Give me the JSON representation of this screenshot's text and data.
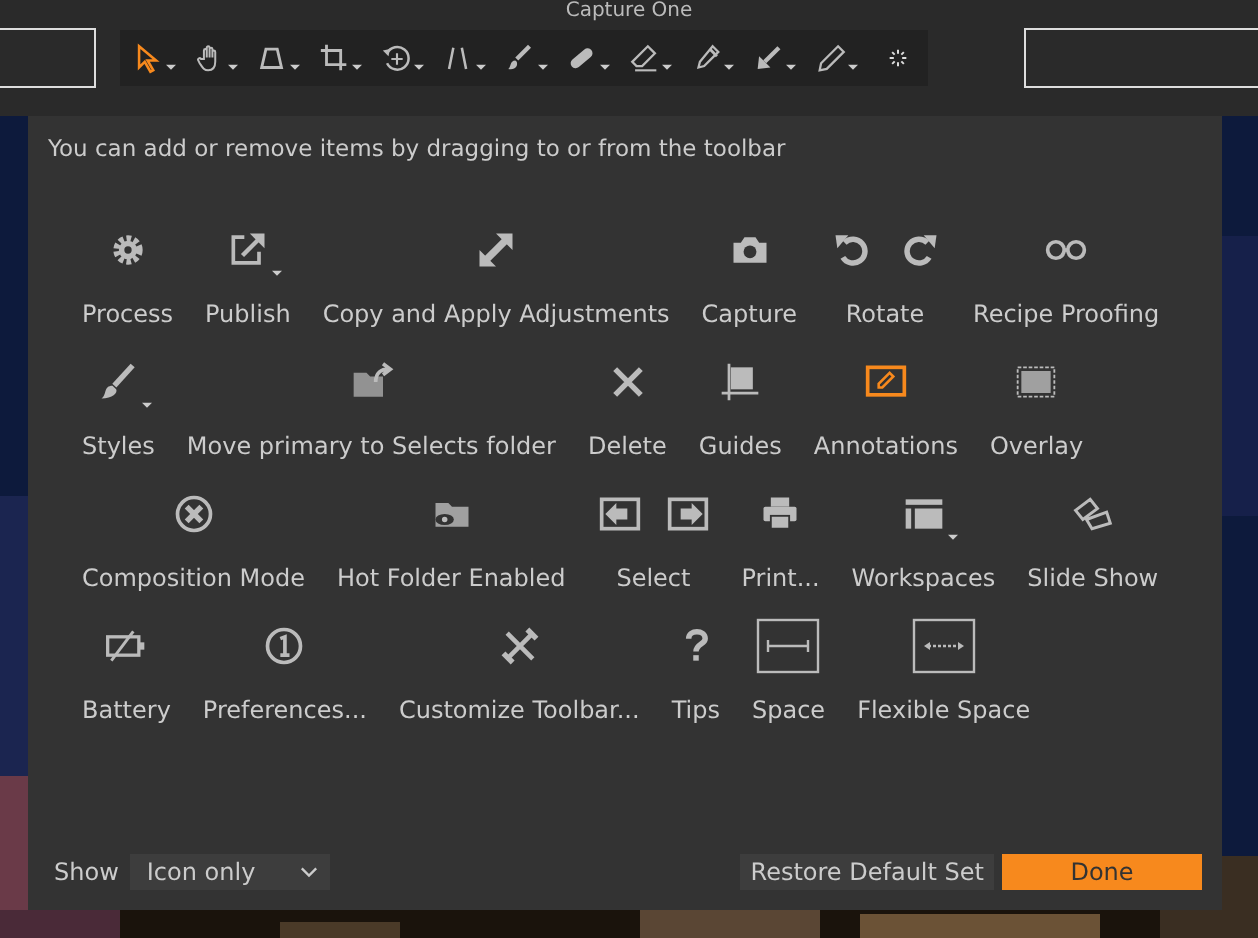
{
  "window": {
    "title": "Capture One"
  },
  "toolbar": [
    {
      "selected": true
    },
    {
      "selected": false
    },
    {
      "selected": false
    },
    {
      "selected": false
    },
    {
      "selected": false
    },
    {
      "selected": false
    },
    {
      "selected": false
    },
    {
      "selected": false
    },
    {
      "selected": false
    },
    {
      "selected": false
    },
    {
      "selected": false
    },
    {
      "selected": false
    }
  ],
  "dialog": {
    "hint": "You can add or remove items by dragging to or from the toolbar",
    "rows": [
      [
        {
          "label": "Process",
          "dropdown": false,
          "selected": false
        },
        {
          "label": "Publish",
          "dropdown": true,
          "selected": false
        },
        {
          "label": "Copy and Apply Adjustments",
          "dropdown": false,
          "selected": false
        },
        {
          "label": "Capture",
          "dropdown": false,
          "selected": false
        },
        {
          "label": "Rotate",
          "dropdown": false,
          "selected": false
        },
        {
          "label": "Recipe Proofing",
          "dropdown": false,
          "selected": false
        }
      ],
      [
        {
          "label": "Styles",
          "dropdown": true,
          "selected": false
        },
        {
          "label": "Move primary to Selects folder",
          "dropdown": false,
          "selected": false
        },
        {
          "label": "Delete",
          "dropdown": false,
          "selected": false
        },
        {
          "label": "Guides",
          "dropdown": false,
          "selected": false
        },
        {
          "label": "Annotations",
          "dropdown": false,
          "selected": true
        },
        {
          "label": "Overlay",
          "dropdown": false,
          "selected": false
        }
      ],
      [
        {
          "label": "Composition Mode",
          "dropdown": false,
          "selected": false
        },
        {
          "label": "Hot Folder Enabled",
          "dropdown": false,
          "selected": false
        },
        {
          "label": "Select",
          "dropdown": false,
          "selected": false
        },
        {
          "label": "Print...",
          "dropdown": false,
          "selected": false
        },
        {
          "label": "Workspaces",
          "dropdown": true,
          "selected": false
        },
        {
          "label": "Slide Show",
          "dropdown": false,
          "selected": false
        }
      ],
      [
        {
          "label": "Battery",
          "dropdown": false,
          "selected": false
        },
        {
          "label": "Preferences...",
          "dropdown": false,
          "selected": false
        },
        {
          "label": "Customize Toolbar...",
          "dropdown": false,
          "selected": false
        },
        {
          "label": "Tips",
          "dropdown": false,
          "selected": false
        },
        {
          "label": "Space",
          "dropdown": false,
          "selected": false
        },
        {
          "label": "Flexible Space",
          "dropdown": false,
          "selected": false
        }
      ]
    ],
    "show_label": "Show",
    "show_value": "Icon only",
    "buttons": [
      "Restore Default Set",
      "Done"
    ]
  }
}
